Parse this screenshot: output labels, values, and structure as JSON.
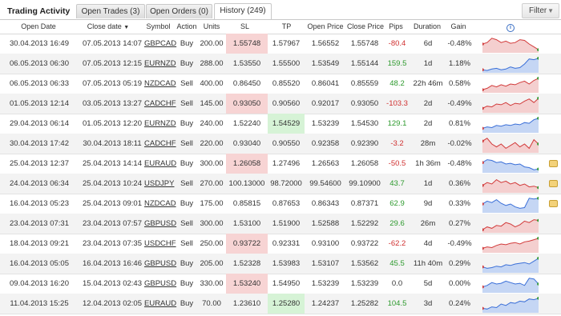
{
  "app_title": "Trading Activity",
  "tabs": [
    {
      "label": "Open Trades (3)",
      "active": false
    },
    {
      "label": "Open Orders (0)",
      "active": false
    },
    {
      "label": "History (249)",
      "active": true
    }
  ],
  "filter_label": "Filter",
  "filter_icon": "chevron-down-icon",
  "columns": {
    "open_date": "Open Date",
    "close_date": "Close date",
    "symbol": "Symbol",
    "action": "Action",
    "units": "Units",
    "sl": "SL",
    "tp": "TP",
    "open_price": "Open Price",
    "close_price": "Close Price",
    "pips": "Pips",
    "duration": "Duration",
    "gain": "Gain",
    "chart": "info-icon"
  },
  "colors": {
    "positive": "#2e9a2e",
    "negative": "#d03030",
    "sl_hit": "#f7d4d4",
    "tp_hit": "#d6f3d6",
    "spark_up": "#3a6fd8",
    "spark_down": "#d23a3a"
  },
  "rows": [
    {
      "open_date": "30.04.2013 16:49",
      "close_date": "07.05.2013 14:07",
      "symbol": "GBPCAD",
      "action": "Buy",
      "units": "200.00",
      "sl": "1.55748",
      "tp": "1.57967",
      "open_price": "1.56552",
      "close_price": "1.55748",
      "pips": "-80.4",
      "duration": "6d",
      "gain": "-0.48%",
      "sl_hit": true,
      "tp_hit": false,
      "comment": false,
      "spark": [
        0.5,
        0.6,
        0.9,
        0.8,
        0.6,
        0.7,
        0.55,
        0.6,
        0.8,
        0.75,
        0.5,
        0.3,
        0.1
      ],
      "trend": "down"
    },
    {
      "open_date": "06.05.2013 06:30",
      "close_date": "07.05.2013 12:15",
      "symbol": "EURNZD",
      "action": "Buy",
      "units": "288.00",
      "sl": "1.53550",
      "tp": "1.55500",
      "open_price": "1.53549",
      "close_price": "1.55144",
      "pips": "159.5",
      "duration": "1d",
      "gain": "1.18%",
      "sl_hit": false,
      "tp_hit": false,
      "comment": false,
      "spark": [
        0.1,
        0.05,
        0.15,
        0.2,
        0.1,
        0.15,
        0.3,
        0.2,
        0.25,
        0.5,
        0.85,
        0.8,
        0.9
      ],
      "trend": "up"
    },
    {
      "open_date": "06.05.2013 06:33",
      "close_date": "07.05.2013 05:19",
      "symbol": "NZDCAD",
      "action": "Sell",
      "units": "400.00",
      "sl": "0.86450",
      "tp": "0.85520",
      "open_price": "0.86041",
      "close_price": "0.85559",
      "pips": "48.2",
      "duration": "22h 46m",
      "gain": "0.58%",
      "sl_hit": false,
      "tp_hit": false,
      "comment": false,
      "spark": [
        0.1,
        0.2,
        0.4,
        0.3,
        0.45,
        0.35,
        0.5,
        0.45,
        0.6,
        0.7,
        0.5,
        0.75,
        0.9
      ],
      "trend": "down"
    },
    {
      "open_date": "01.05.2013 12:14",
      "close_date": "03.05.2013 13:27",
      "symbol": "CADCHF",
      "action": "Sell",
      "units": "145.00",
      "sl": "0.93050",
      "tp": "0.90560",
      "open_price": "0.92017",
      "close_price": "0.93050",
      "pips": "-103.3",
      "duration": "2d",
      "gain": "-0.49%",
      "sl_hit": true,
      "tp_hit": false,
      "comment": false,
      "spark": [
        0.2,
        0.35,
        0.3,
        0.5,
        0.45,
        0.6,
        0.4,
        0.55,
        0.5,
        0.7,
        0.85,
        0.6,
        0.9
      ],
      "trend": "down"
    },
    {
      "open_date": "29.04.2013 06:14",
      "close_date": "01.05.2013 12:20",
      "symbol": "EURNZD",
      "action": "Buy",
      "units": "240.00",
      "sl": "1.52240",
      "tp": "1.54529",
      "open_price": "1.53239",
      "close_price": "1.54530",
      "pips": "129.1",
      "duration": "2d",
      "gain": "0.81%",
      "sl_hit": false,
      "tp_hit": true,
      "comment": false,
      "spark": [
        0.2,
        0.3,
        0.25,
        0.4,
        0.35,
        0.45,
        0.4,
        0.5,
        0.45,
        0.6,
        0.55,
        0.8,
        0.9
      ],
      "trend": "up"
    },
    {
      "open_date": "30.04.2013 17:42",
      "close_date": "30.04.2013 18:11",
      "symbol": "CADCHF",
      "action": "Sell",
      "units": "220.00",
      "sl": "0.93040",
      "tp": "0.90550",
      "open_price": "0.92358",
      "close_price": "0.92390",
      "pips": "-3.2",
      "duration": "28m",
      "gain": "-0.02%",
      "sl_hit": false,
      "tp_hit": false,
      "comment": false,
      "spark": [
        0.7,
        0.9,
        0.5,
        0.3,
        0.5,
        0.2,
        0.4,
        0.6,
        0.3,
        0.5,
        0.2,
        0.8,
        0.5
      ],
      "trend": "down"
    },
    {
      "open_date": "25.04.2013 12:37",
      "close_date": "25.04.2013 14:14",
      "symbol": "EURAUD",
      "action": "Buy",
      "units": "300.00",
      "sl": "1.26058",
      "tp": "1.27496",
      "open_price": "1.26563",
      "close_price": "1.26058",
      "pips": "-50.5",
      "duration": "1h 36m",
      "gain": "-0.48%",
      "sl_hit": true,
      "tp_hit": false,
      "comment": true,
      "spark": [
        0.6,
        0.8,
        0.75,
        0.6,
        0.65,
        0.5,
        0.55,
        0.45,
        0.5,
        0.3,
        0.25,
        0.1,
        0.15
      ],
      "trend": "up"
    },
    {
      "open_date": "24.04.2013 06:34",
      "close_date": "25.04.2013 10:24",
      "symbol": "USDJPY",
      "action": "Sell",
      "units": "270.00",
      "sl": "100.13000",
      "tp": "98.72000",
      "open_price": "99.54600",
      "close_price": "99.10900",
      "pips": "43.7",
      "duration": "1d",
      "gain": "0.36%",
      "sl_hit": false,
      "tp_hit": false,
      "comment": true,
      "spark": [
        0.4,
        0.6,
        0.5,
        0.8,
        0.6,
        0.7,
        0.5,
        0.6,
        0.4,
        0.5,
        0.3,
        0.35,
        0.25
      ],
      "trend": "down"
    },
    {
      "open_date": "16.04.2013 05:23",
      "close_date": "25.04.2013 09:01",
      "symbol": "NZDCAD",
      "action": "Buy",
      "units": "175.00",
      "sl": "0.85815",
      "tp": "0.87653",
      "open_price": "0.86343",
      "close_price": "0.87371",
      "pips": "62.9",
      "duration": "9d",
      "gain": "0.33%",
      "sl_hit": false,
      "tp_hit": false,
      "comment": true,
      "spark": [
        0.5,
        0.7,
        0.6,
        0.8,
        0.55,
        0.4,
        0.5,
        0.3,
        0.2,
        0.25,
        0.9,
        0.85,
        0.9
      ],
      "trend": "up"
    },
    {
      "open_date": "23.04.2013 07:31",
      "close_date": "23.04.2013 07:57",
      "symbol": "GBPUSD",
      "action": "Sell",
      "units": "300.00",
      "sl": "1.53100",
      "tp": "1.51900",
      "open_price": "1.52588",
      "close_price": "1.52292",
      "pips": "29.6",
      "duration": "26m",
      "gain": "0.27%",
      "sl_hit": false,
      "tp_hit": false,
      "comment": false,
      "spark": [
        0.1,
        0.3,
        0.2,
        0.4,
        0.35,
        0.6,
        0.5,
        0.3,
        0.45,
        0.7,
        0.6,
        0.8,
        0.75
      ],
      "trend": "down"
    },
    {
      "open_date": "18.04.2013 09:21",
      "close_date": "23.04.2013 07:35",
      "symbol": "USDCHF",
      "action": "Sell",
      "units": "250.00",
      "sl": "0.93722",
      "tp": "0.92331",
      "open_price": "0.93100",
      "close_price": "0.93722",
      "pips": "-62.2",
      "duration": "4d",
      "gain": "-0.49%",
      "sl_hit": true,
      "tp_hit": false,
      "comment": false,
      "spark": [
        0.2,
        0.3,
        0.25,
        0.4,
        0.5,
        0.45,
        0.55,
        0.6,
        0.5,
        0.65,
        0.7,
        0.8,
        0.9
      ],
      "trend": "down"
    },
    {
      "open_date": "16.04.2013 05:05",
      "close_date": "16.04.2013 16:46",
      "symbol": "GBPUSD",
      "action": "Buy",
      "units": "205.00",
      "sl": "1.52328",
      "tp": "1.53983",
      "open_price": "1.53107",
      "close_price": "1.53562",
      "pips": "45.5",
      "duration": "11h 40m",
      "gain": "0.29%",
      "sl_hit": false,
      "tp_hit": false,
      "comment": false,
      "spark": [
        0.3,
        0.2,
        0.25,
        0.35,
        0.3,
        0.45,
        0.4,
        0.5,
        0.55,
        0.6,
        0.5,
        0.7,
        0.9
      ],
      "trend": "up"
    },
    {
      "open_date": "09.04.2013 16:20",
      "close_date": "15.04.2013 02:43",
      "symbol": "GBPUSD",
      "action": "Buy",
      "units": "330.00",
      "sl": "1.53240",
      "tp": "1.54950",
      "open_price": "1.53239",
      "close_price": "1.53239",
      "pips": "0.0",
      "duration": "5d",
      "gain": "0.00%",
      "sl_hit": true,
      "tp_hit": false,
      "comment": false,
      "spark": [
        0.3,
        0.4,
        0.6,
        0.5,
        0.55,
        0.7,
        0.6,
        0.5,
        0.55,
        0.4,
        0.9,
        0.85,
        0.5
      ],
      "trend": "up"
    },
    {
      "open_date": "11.04.2013 15:25",
      "close_date": "12.04.2013 02:05",
      "symbol": "EURAUD",
      "action": "Buy",
      "units": "70.00",
      "sl": "1.23610",
      "tp": "1.25280",
      "open_price": "1.24237",
      "close_price": "1.25282",
      "pips": "104.5",
      "duration": "3d",
      "gain": "0.24%",
      "sl_hit": false,
      "tp_hit": true,
      "comment": false,
      "spark": [
        0.2,
        0.15,
        0.3,
        0.25,
        0.5,
        0.4,
        0.6,
        0.55,
        0.7,
        0.65,
        0.85,
        0.8,
        0.9
      ],
      "trend": "up"
    }
  ]
}
